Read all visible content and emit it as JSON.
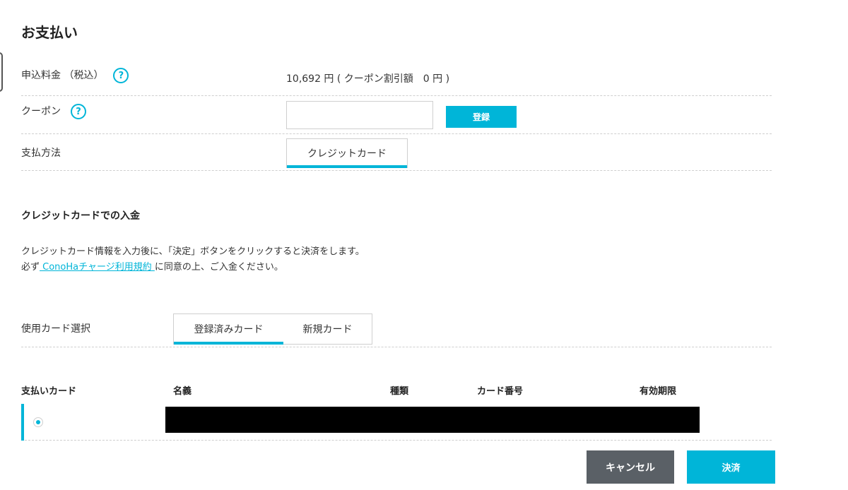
{
  "page": {
    "title": "お支払い"
  },
  "fee": {
    "label": "申込料金 （税込）",
    "help_icon": "question-circle-icon",
    "value": "10,692 円 ( クーポン割引額　0 円 )"
  },
  "coupon": {
    "label": "クーポン",
    "help_icon": "question-circle-icon",
    "input_value": "",
    "register_label": "登録"
  },
  "payment_method": {
    "label": "支払方法",
    "selected": "クレジットカード"
  },
  "credit_section": {
    "title": "クレジットカードでの入金",
    "description_line1": "クレジットカード情報を入力後に、「決定」ボタンをクリックすると決済をします。",
    "description_prefix": "必ず",
    "terms_link": " ConoHaチャージ利用規約 ",
    "description_suffix": "に同意の上、ご入金ください。"
  },
  "card_select": {
    "label": "使用カード選択",
    "tabs": [
      {
        "label": "登録済みカード",
        "active": true
      },
      {
        "label": "新規カード",
        "active": false
      }
    ]
  },
  "card_table": {
    "headers": {
      "payment_card": "支払いカード",
      "name": "名義",
      "type": "種類",
      "number": "カード番号",
      "expiry": "有効期限"
    },
    "rows": [
      {
        "selected": true,
        "redacted": true
      }
    ]
  },
  "actions": {
    "cancel_label": "キャンセル",
    "pay_label": "決済"
  },
  "colors": {
    "accent": "#00b5d8",
    "cancel_bg": "#5a6066",
    "text": "#333333"
  }
}
